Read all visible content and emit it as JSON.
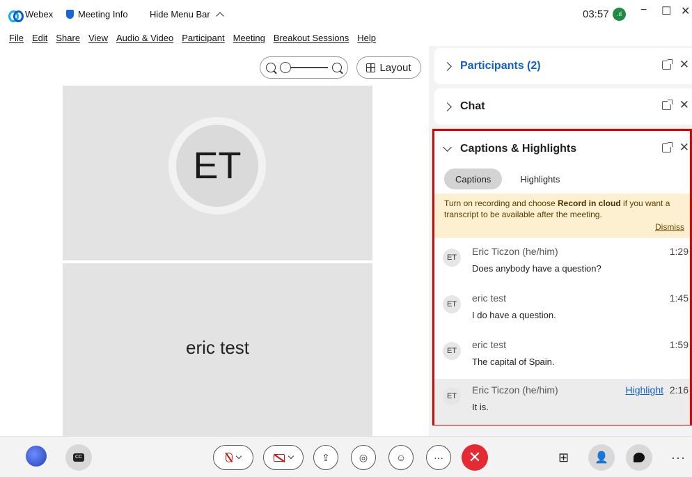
{
  "titlebar": {
    "app_name": "Webex",
    "meeting_info": "Meeting Info",
    "hide_menu": "Hide Menu Bar",
    "clock": "03:57",
    "minimize": "−",
    "maximize": "☐",
    "close": "✕"
  },
  "menu": [
    "File",
    "Edit",
    "Share",
    "View",
    "Audio & Video",
    "Participant",
    "Meeting",
    "Breakout Sessions",
    "Help"
  ],
  "stage": {
    "layout_label": "Layout",
    "tiles": [
      {
        "initials": "ET"
      },
      {
        "name": "eric test"
      }
    ]
  },
  "panel": {
    "participants": {
      "title": "Participants (2)"
    },
    "chat": {
      "title": "Chat"
    },
    "captions": {
      "title": "Captions & Highlights",
      "tabs": [
        "Captions",
        "Highlights"
      ],
      "notice_pre": "Turn on recording and choose ",
      "notice_bold": "Record in cloud",
      "notice_post": " if you want a transcript to be available after the meeting.",
      "dismiss": "Dismiss",
      "entries": [
        {
          "initials": "ET",
          "name": "Eric Ticzon (he/him)",
          "time": "1:29",
          "text": "Does anybody have a question?"
        },
        {
          "initials": "ET",
          "name": "eric test",
          "time": "1:45",
          "text": "I do have a question."
        },
        {
          "initials": "ET",
          "name": "eric test",
          "time": "1:59",
          "text": "The capital of Spain."
        },
        {
          "initials": "ET",
          "name": "Eric Ticzon (he/him)",
          "time": "2:16",
          "text": "It is.",
          "highlight_label": "Highlight"
        }
      ]
    }
  },
  "toolbar": {
    "cc_badge": "CC",
    "end_symbol": "✕",
    "more": "···"
  },
  "colors": {
    "accent": "#1060c9",
    "end_call": "#e42b34",
    "highlight_border": "#e00000",
    "notice_bg": "#fdf0d0"
  }
}
